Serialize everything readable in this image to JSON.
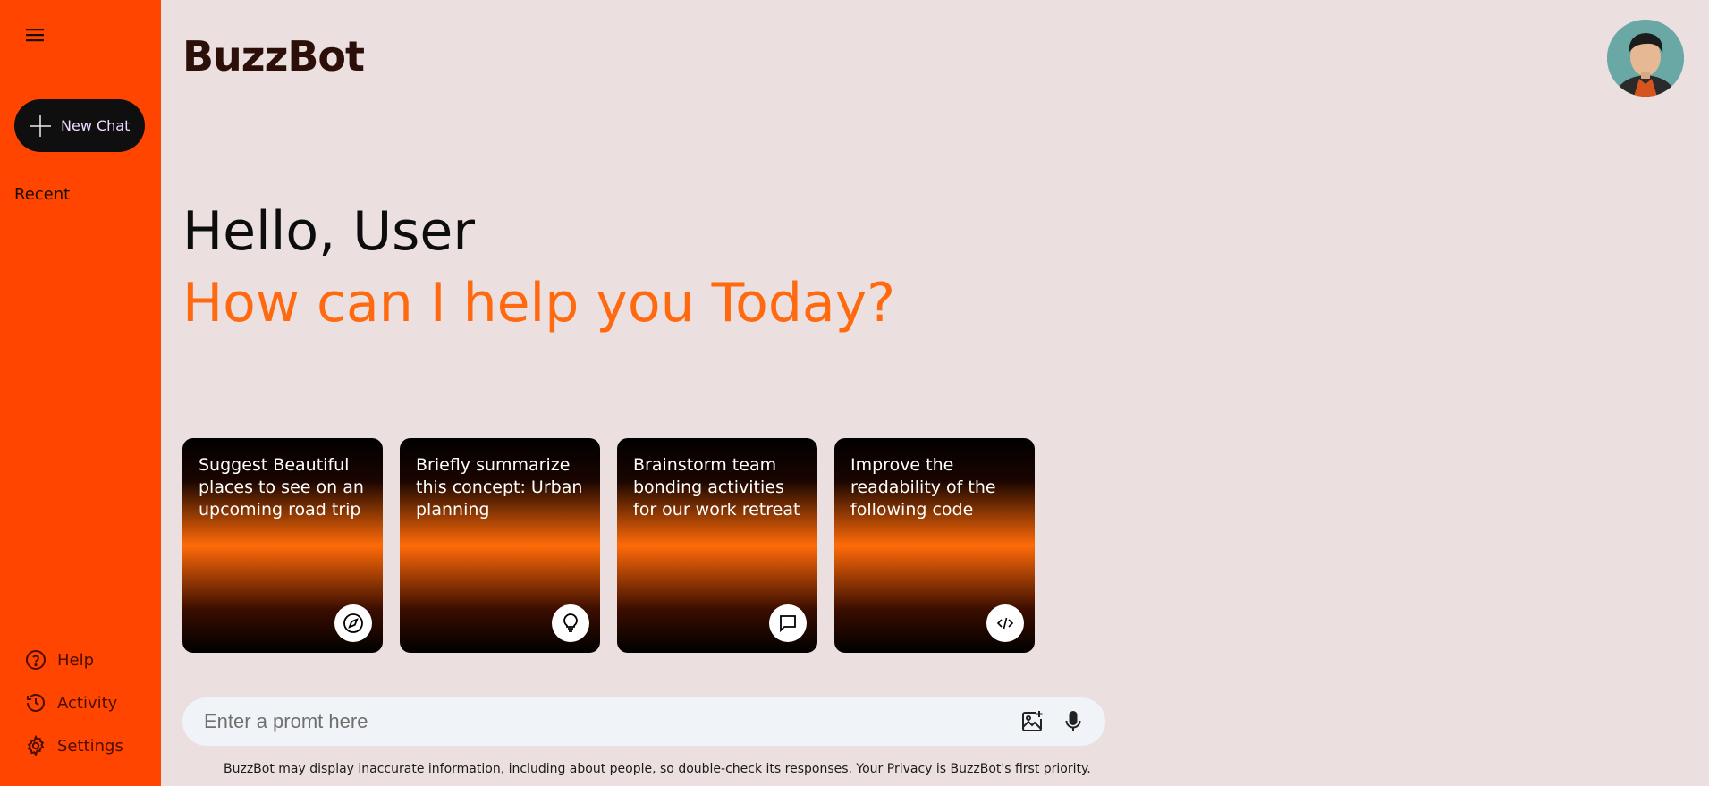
{
  "app": {
    "title": "BuzzBot"
  },
  "sidebar": {
    "new_chat_label": "New Chat",
    "recent_label": "Recent",
    "bottom_items": [
      {
        "label": "Help",
        "icon": "help-circle-icon"
      },
      {
        "label": "Activity",
        "icon": "history-icon"
      },
      {
        "label": "Settings",
        "icon": "gear-icon"
      }
    ]
  },
  "main": {
    "greeting": "Hello, User",
    "subtitle": "How can I help you Today?",
    "cards": [
      {
        "text": "Suggest Beautiful places to see on an upcoming road trip",
        "icon": "compass-icon"
      },
      {
        "text": "Briefly summarize this concept: Urban planning",
        "icon": "lightbulb-icon"
      },
      {
        "text": "Brainstorm team bonding activities for our work retreat",
        "icon": "message-icon"
      },
      {
        "text": "Improve the readability of the following code",
        "icon": "code-icon"
      }
    ],
    "prompt": {
      "placeholder": "Enter a promt here"
    },
    "disclaimer": "BuzzBot may display inaccurate information, including about people, so double-check its responses. Your Privacy is BuzzBot's first priority."
  },
  "colors": {
    "sidebar_bg": "#ff4500",
    "page_bg": "#ebdfe0",
    "accent": "#ff6a10",
    "dark": "#0f0f0f"
  }
}
